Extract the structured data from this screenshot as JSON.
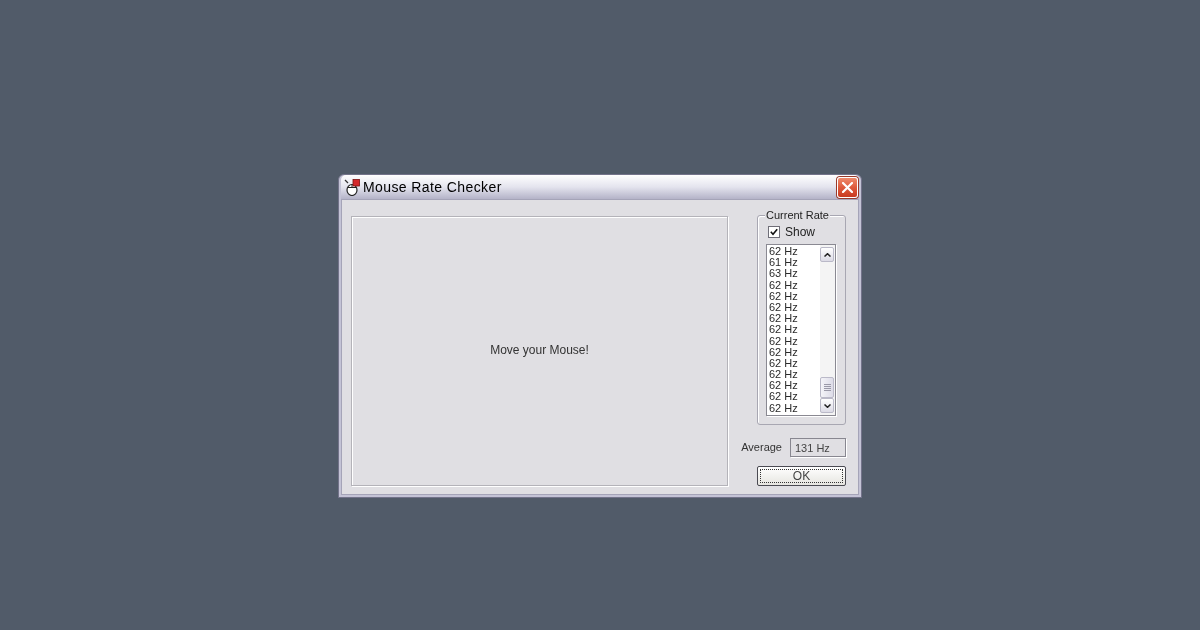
{
  "window": {
    "title": "Mouse Rate Checker"
  },
  "test_area": {
    "message": "Move your Mouse!"
  },
  "current_rate": {
    "title": "Current Rate",
    "show": {
      "label": "Show",
      "checked": true
    },
    "readings": [
      "62 Hz",
      "61 Hz",
      "63 Hz",
      "62 Hz",
      "62 Hz",
      "62 Hz",
      "62 Hz",
      "62 Hz",
      "62 Hz",
      "62 Hz",
      "62 Hz",
      "62 Hz",
      "62 Hz",
      "62 Hz",
      "62 Hz"
    ]
  },
  "average": {
    "label": "Average",
    "value": "131 Hz"
  },
  "buttons": [
    {
      "label": "OK",
      "focused": true
    }
  ]
}
